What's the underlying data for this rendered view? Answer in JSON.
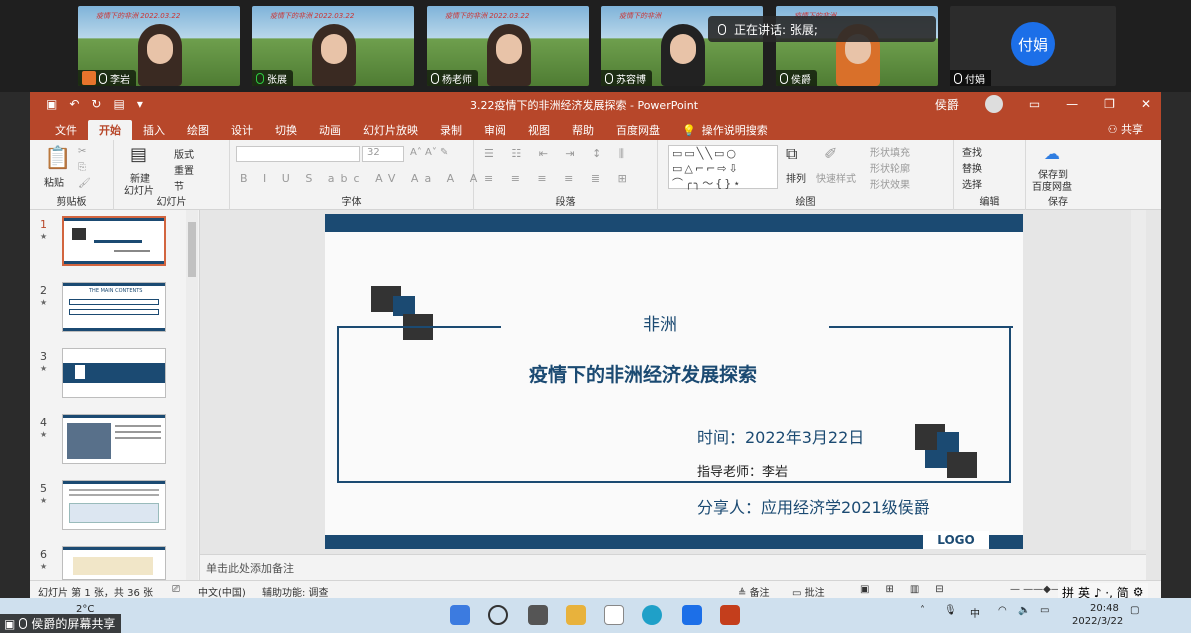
{
  "video_strip": {
    "participants": [
      {
        "name": "李岩",
        "host": true,
        "banner": "疫情下的非洲   2022.03.22"
      },
      {
        "name": "张展",
        "mic": "green",
        "banner": "疫情下的非洲   2022.03.22"
      },
      {
        "name": "杨老师",
        "banner": "疫情下的非洲   2022.03.22"
      },
      {
        "name": "苏容博",
        "banner": "疫情下的非洲"
      },
      {
        "name": "侯爵",
        "banner": "疫情下的非洲"
      },
      {
        "name": "付娟",
        "avatar_text": "付娟"
      }
    ],
    "speaking": "正在讲话: 张展;"
  },
  "ppt": {
    "doc_title": "3.22疫情下的非洲经济发展探索  -  PowerPoint",
    "user_name": "侯爵",
    "tabs": [
      "文件",
      "开始",
      "插入",
      "绘图",
      "设计",
      "切换",
      "动画",
      "幻灯片放映",
      "录制",
      "审阅",
      "视图",
      "帮助",
      "百度网盘",
      "操作说明搜索"
    ],
    "share_label": "共享",
    "ribbon": {
      "paste": "粘贴",
      "clipboard": "剪贴板",
      "new_slide": "新建",
      "new_slide2": "幻灯片",
      "layout": "版式",
      "reset": "重置",
      "section": "节",
      "slides_group": "幻灯片",
      "font_size": "32",
      "font_group": "字体",
      "paragraph_group": "段落",
      "arrange": "排列",
      "quick_styles": "快速样式",
      "shape_fill": "形状填充",
      "shape_outline": "形状轮廓",
      "shape_effect": "形状效果",
      "drawing_group": "绘图",
      "find": "查找",
      "replace": "替换",
      "select": "选择",
      "editing_group": "编辑",
      "save_baidu": "保存到",
      "save_baidu2": "百度网盘",
      "save_group": "保存"
    },
    "slide": {
      "subtitle": "非洲",
      "title": "疫情下的非洲经济发展探索",
      "date": "时间：2022年3月22日",
      "teacher": "指导老师：李岩",
      "presenter": "分享人：应用经济学2021级侯爵",
      "logo": "LOGO"
    },
    "thumb_numbers": [
      "1",
      "2",
      "3",
      "4",
      "5",
      "6"
    ],
    "thumb2_heading": "THE MAIN CONTENTS",
    "notes_placeholder": "单击此处添加备注",
    "status": {
      "slide_count": "幻灯片 第 1 张，共 36 张",
      "language": "中文(中国)",
      "accessibility": "辅助功能: 调查",
      "notes": "备注",
      "comments": "批注"
    }
  },
  "taskbar": {
    "weather": "2°C",
    "ime_mode": "中",
    "time": "20:48",
    "date": "2022/3/22"
  },
  "ime_bar": "英 ♪ ·, 简",
  "screen_share_label": "侯爵的屏幕共享",
  "colors": {
    "ppt_accent": "#b7472a",
    "slide_navy": "#1b4a72",
    "avatar_blue": "#1c6fe8"
  }
}
